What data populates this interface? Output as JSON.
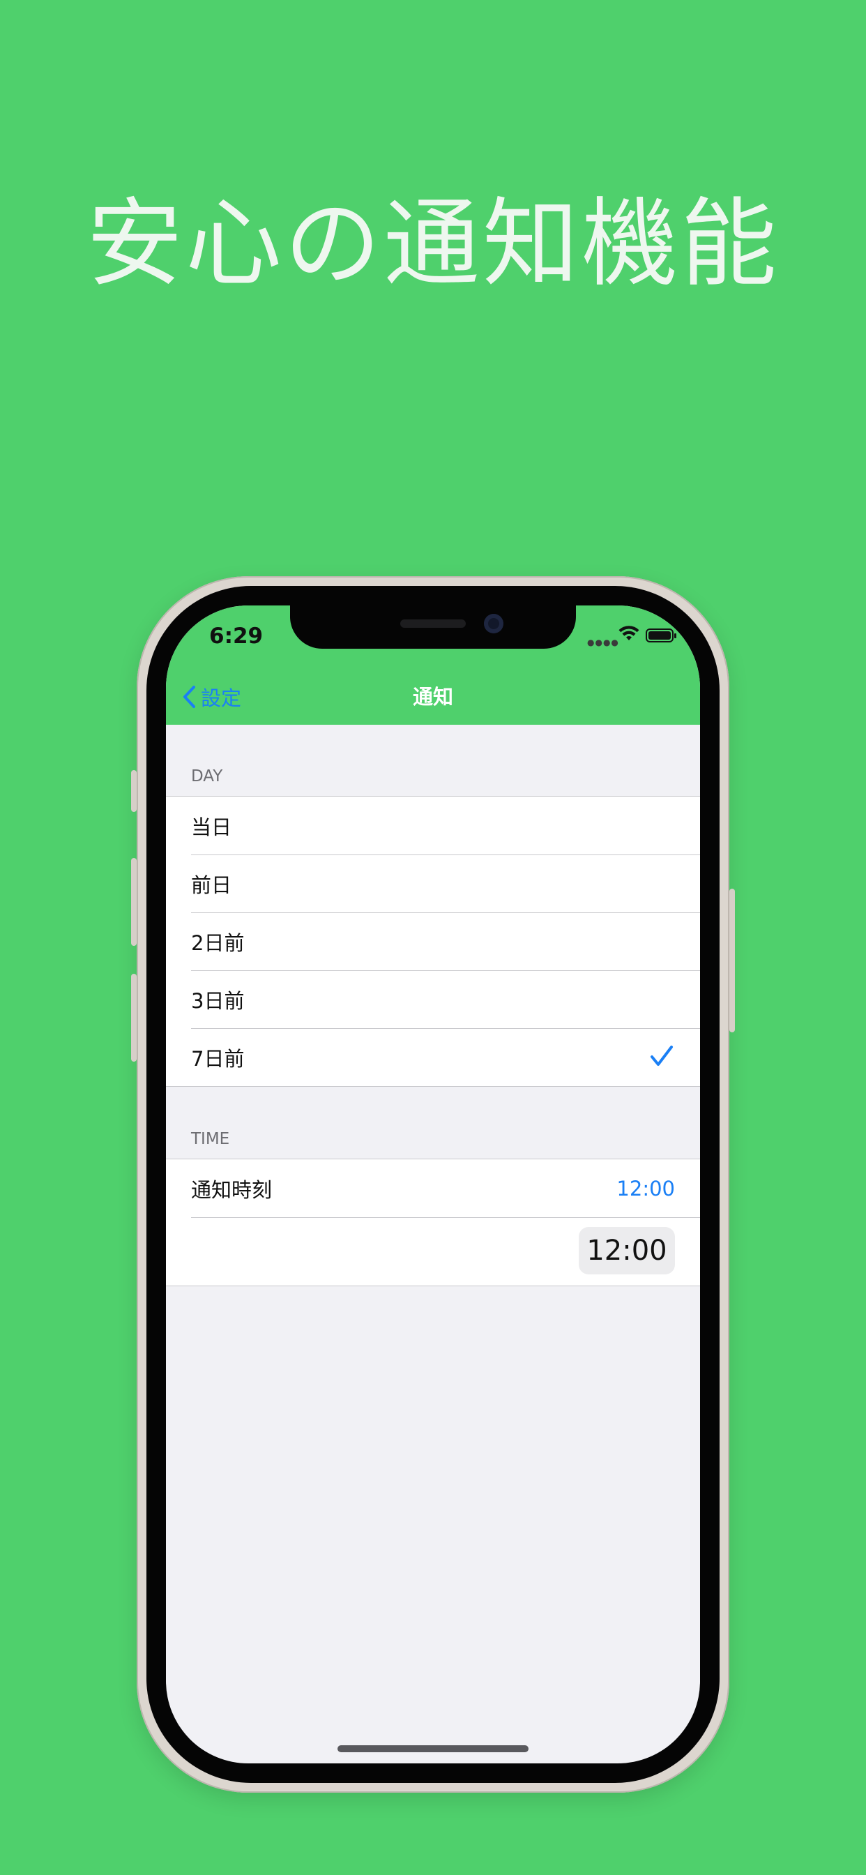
{
  "headline": "安心の通知機能",
  "status_bar": {
    "time": "6:29"
  },
  "nav": {
    "back_label": "設定",
    "title": "通知"
  },
  "day_section": {
    "header": "DAY",
    "items": [
      {
        "label": "当日",
        "selected": false
      },
      {
        "label": "前日",
        "selected": false
      },
      {
        "label": "2日前",
        "selected": false
      },
      {
        "label": "3日前",
        "selected": false
      },
      {
        "label": "7日前",
        "selected": true
      }
    ]
  },
  "time_section": {
    "header": "TIME",
    "row_label": "通知時刻",
    "row_value": "12:00",
    "picker_value": "12:00"
  },
  "colors": {
    "background": "#4fd06c",
    "accent": "#1a7ff5",
    "grouped_background": "#f1f1f5"
  },
  "icons": {
    "back": "chevron-left-icon",
    "selected": "checkmark-icon",
    "wifi": "wifi-icon",
    "battery": "battery-icon"
  }
}
